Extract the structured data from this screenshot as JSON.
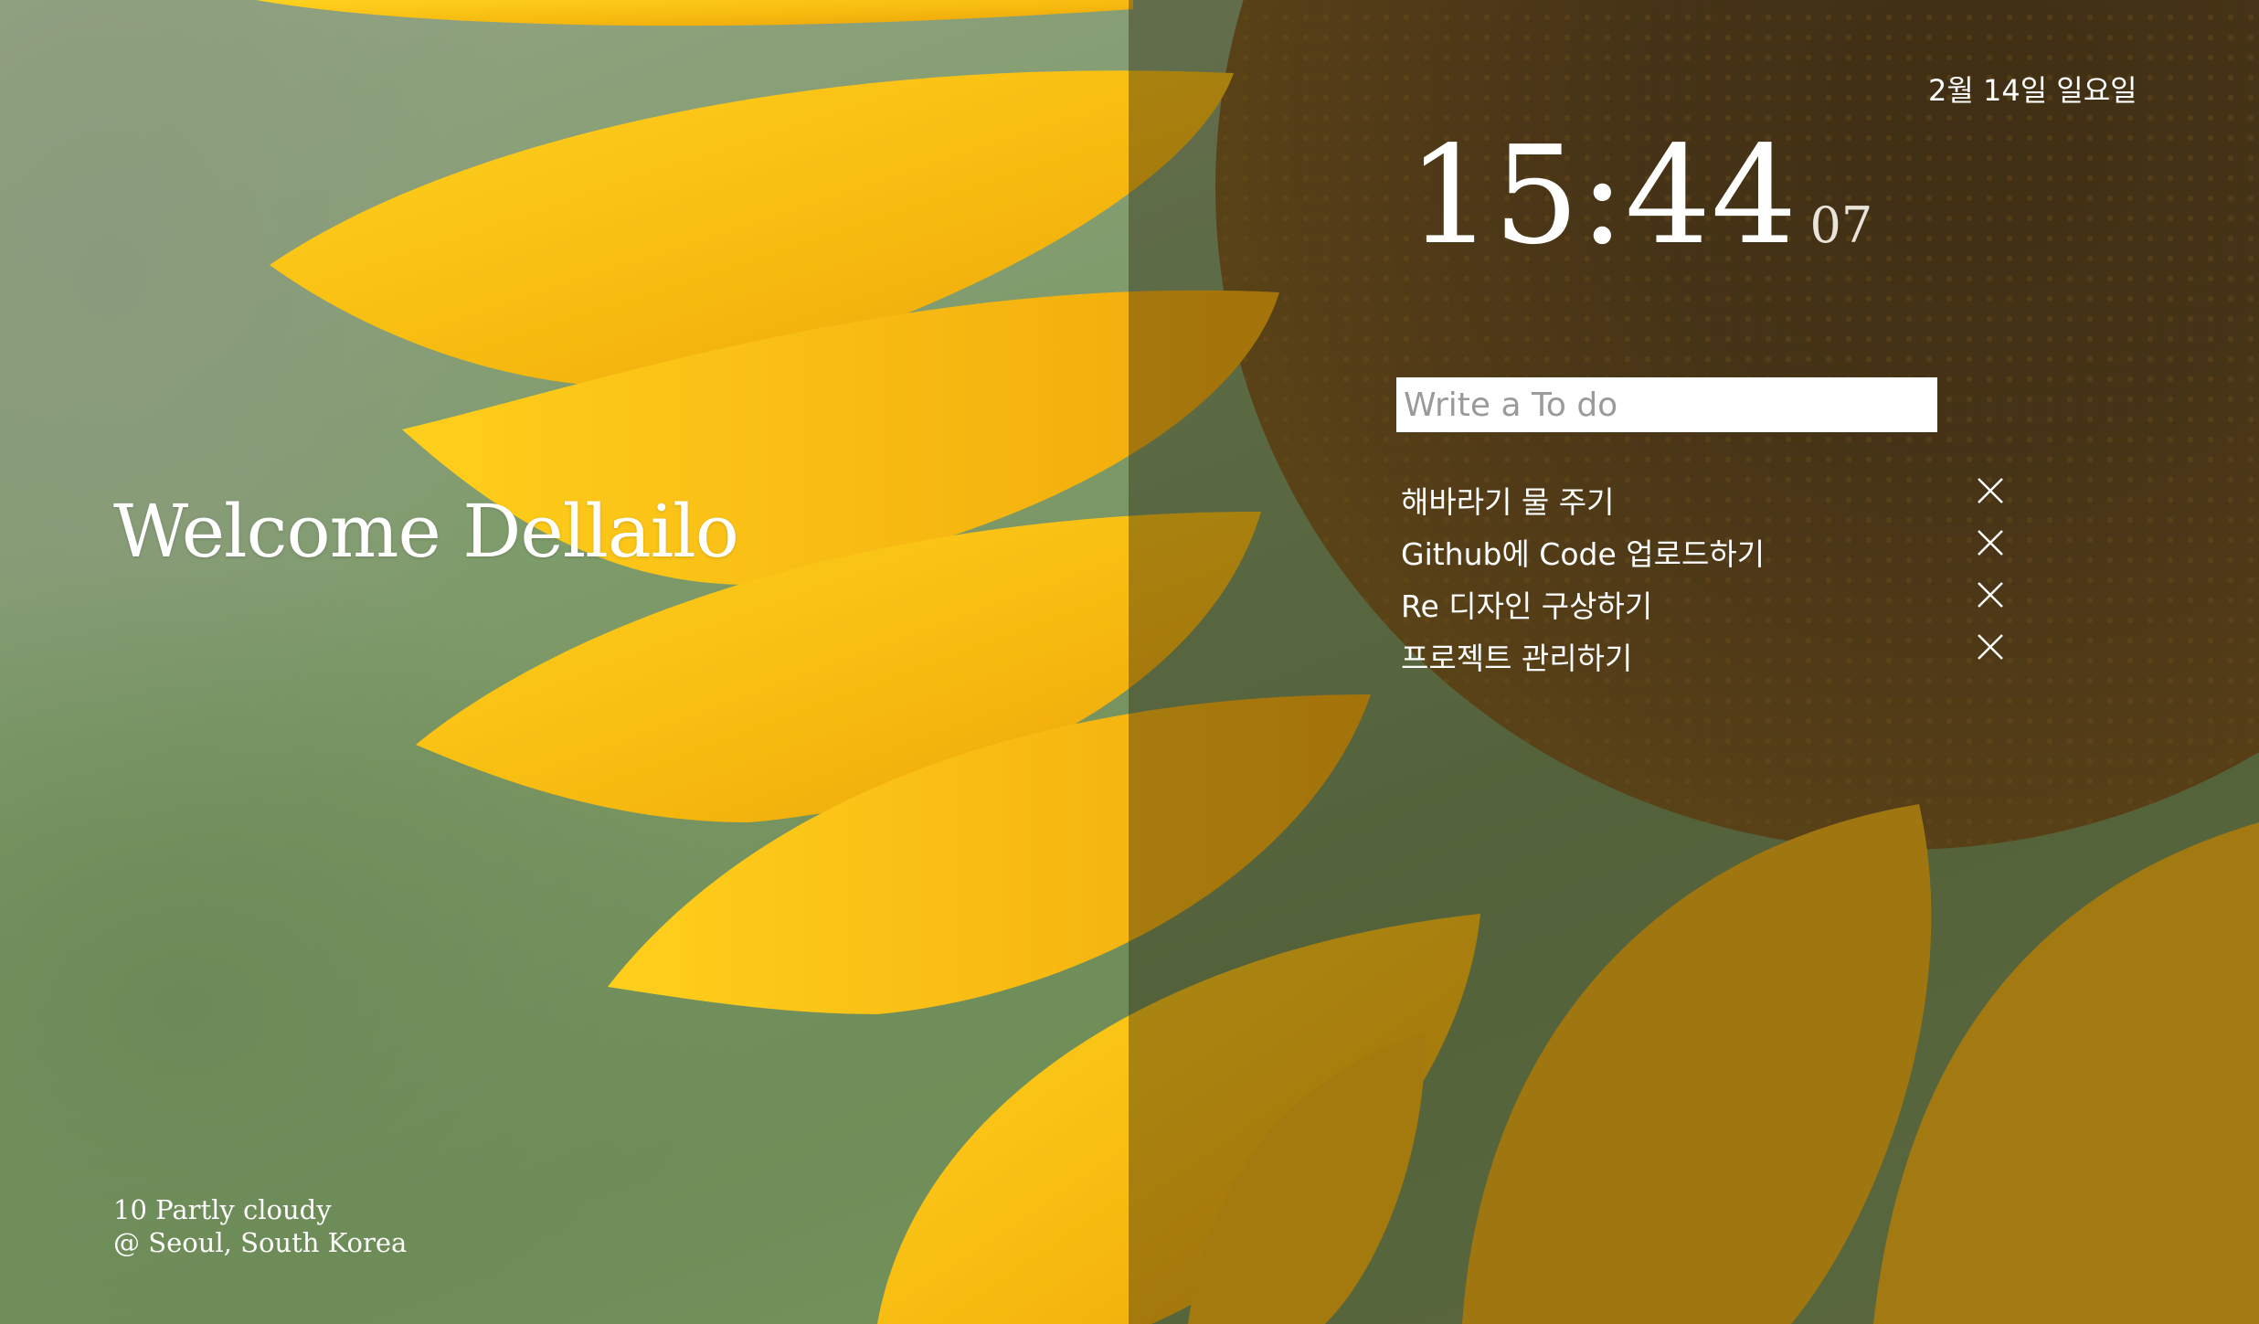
{
  "welcome": {
    "text": "Welcome Dellailo"
  },
  "weather": {
    "line1": "10 Partly cloudy",
    "line2": "@ Seoul, South Korea"
  },
  "date": {
    "text": "2월 14일 일요일"
  },
  "clock": {
    "hours_minutes": "15:44",
    "seconds": "07"
  },
  "todo": {
    "placeholder": "Write a To do",
    "value": "",
    "items": [
      {
        "label": "해바라기 물 주기",
        "delete_icon": "close-icon"
      },
      {
        "label": "Github에 Code 업로드하기",
        "delete_icon": "close-icon"
      },
      {
        "label": "Re 디자인 구상하기",
        "delete_icon": "close-icon"
      },
      {
        "label": "프로젝트 관리하기",
        "delete_icon": "close-icon"
      }
    ]
  },
  "colors": {
    "text": "#ffffff",
    "petal": "#f6be12",
    "petal_dark": "#e9a40c",
    "background_green": "#7a9660"
  }
}
